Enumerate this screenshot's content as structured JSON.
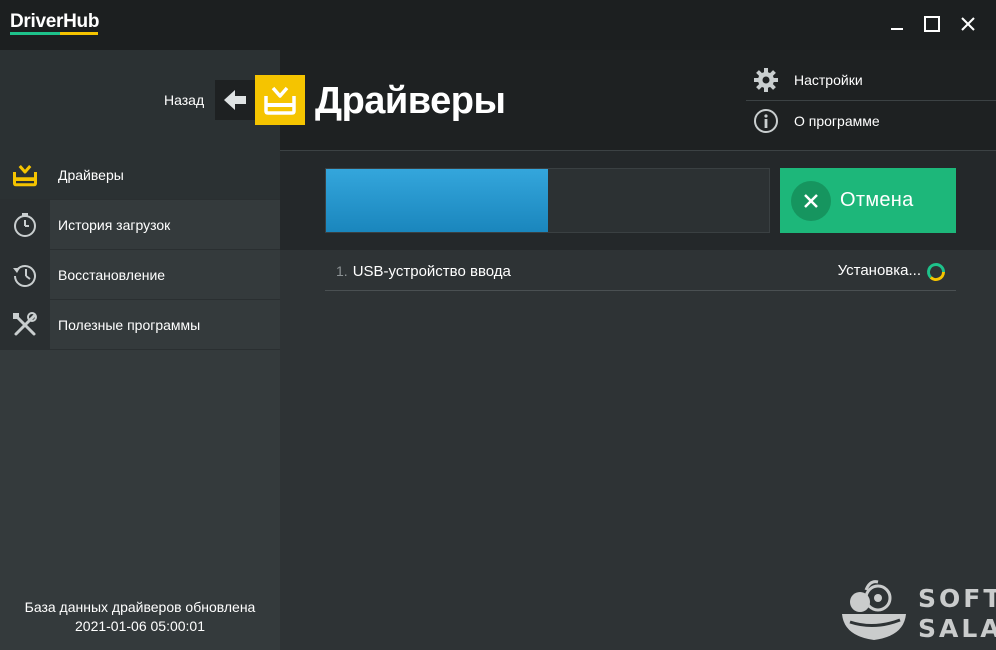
{
  "app": {
    "logo": "DriverHub",
    "logo_colors": [
      "#1ec28b",
      "#f5c400"
    ]
  },
  "window_controls": [
    "minimize-icon",
    "maximize-icon",
    "close-icon"
  ],
  "header": {
    "back_label": "Назад",
    "title": "Драйверы",
    "menu": [
      {
        "label": "Настройки",
        "icon": "gear-icon"
      },
      {
        "label": "О программе",
        "icon": "info-icon"
      }
    ]
  },
  "sidebar": {
    "items": [
      {
        "label": "Драйверы",
        "icon": "drivers-tray-icon",
        "active": true
      },
      {
        "label": "История загрузок",
        "icon": "stopwatch-icon",
        "active": false
      },
      {
        "label": "Восстановление",
        "icon": "restore-clock-icon",
        "active": false
      },
      {
        "label": "Полезные программы",
        "icon": "tools-icon",
        "active": false
      }
    ],
    "db_status_line1": "База данных драйверов обновлена",
    "db_status_line2": "2021-01-06 05:00:01"
  },
  "main": {
    "progress": 0.5,
    "cancel_label": "Отмена",
    "drivers": [
      {
        "num": "1.",
        "name": "USB-устройство ввода",
        "status": "Установка..."
      }
    ]
  },
  "watermark": {
    "line1": "SOFT",
    "line2": "SALAD"
  },
  "colors": {
    "accent_yellow": "#f5c400",
    "accent_green": "#1db77a",
    "progress_blue": "#2a98cf"
  }
}
